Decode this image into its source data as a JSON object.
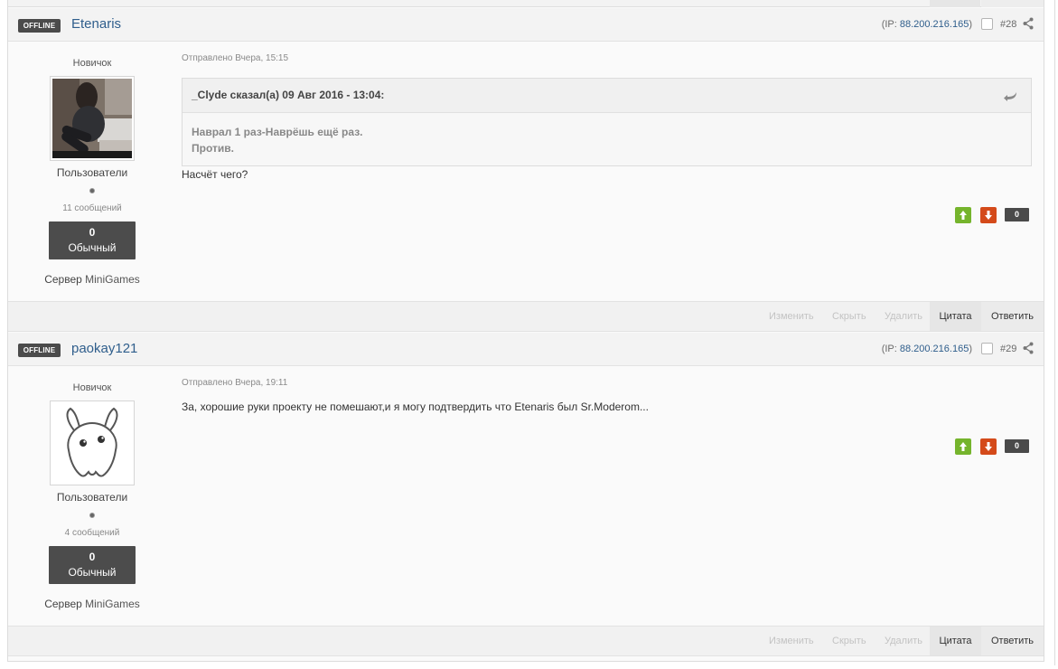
{
  "posts": [
    {
      "status": "OFFLINE",
      "author": "Etenaris",
      "ip_prefix": "(IP: ",
      "ip": "88.200.216.165",
      "ip_suffix": ")",
      "post_number": "#28",
      "rank": "Новичок",
      "group": "Пользователи",
      "message_count": "11 сообщений",
      "reputation_value": "0",
      "reputation_label": "Обычный",
      "server_prefix": "Сервер ",
      "server_name": "MiniGames",
      "posted": "Отправлено Вчера, 15:15",
      "quote": {
        "cite": "_Clyde сказал(а) 09 Авг 2016 - 13:04:",
        "lines": [
          "Наврал 1 раз-Наврёшь ещё раз.",
          "Против."
        ]
      },
      "text": "Насчёт чего?",
      "vote_count": "0",
      "actions": {
        "edit": "Изменить",
        "hide": "Скрыть",
        "delete": "Удалить",
        "quote": "Цитата",
        "reply": "Ответить"
      }
    },
    {
      "status": "OFFLINE",
      "author": "paokay121",
      "ip_prefix": "(IP: ",
      "ip": "88.200.216.165",
      "ip_suffix": ")",
      "post_number": "#29",
      "rank": "Новичок",
      "group": "Пользователи",
      "message_count": "4 сообщений",
      "reputation_value": "0",
      "reputation_label": "Обычный",
      "server_prefix": "Сервер ",
      "server_name": "MiniGames",
      "posted": "Отправлено Вчера, 19:11",
      "text": "За, хорошие руки проекту не помешают,и я могу подтвердить что Etenaris был Sr.Moderom...",
      "vote_count": "0",
      "actions": {
        "edit": "Изменить",
        "hide": "Скрыть",
        "delete": "Удалить",
        "quote": "Цитата",
        "reply": "Ответить"
      }
    }
  ],
  "icons": {
    "share": "share-icon",
    "quote": "quote-arrow-icon",
    "vote_up": "arrow-up-icon",
    "vote_down": "arrow-down-icon",
    "default_avatar": "default-avatar-icon"
  },
  "colors": {
    "vote_up": "#75b42c",
    "vote_down": "#d44a1a",
    "author_link": "#2f5e8c",
    "badge": "#4b4b4b"
  }
}
